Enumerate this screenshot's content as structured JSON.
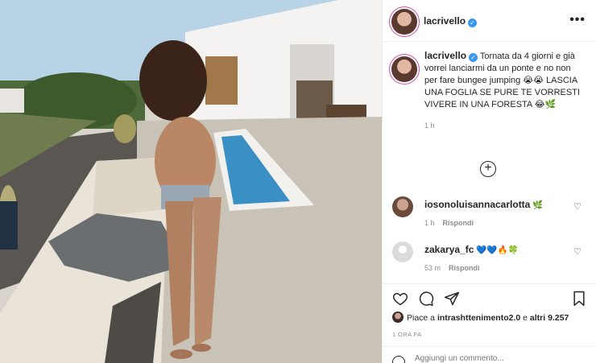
{
  "post": {
    "username": "lacrivello",
    "verified": true
  },
  "caption": {
    "username": "lacrivello",
    "text": "Tornata da 4 giorni e già vorrei lanciarmi da un ponte e no non per fare bungee jumping 😭😭 LASCIA UNA FOGLIA SE PURE TE VORRESTI VIVERE IN UNA FORESTA 😂🌿",
    "time": "1 h"
  },
  "comments": [
    {
      "username": "iosonoluisannacarlotta",
      "text": "🌿",
      "time": "1 h",
      "reply": "Rispondi"
    },
    {
      "username": "zakarya_fc",
      "text": "💙💙🔥🍀",
      "time": "53 m",
      "reply": "Rispondi"
    }
  ],
  "likes": {
    "prefix": "Piace a",
    "user": "intrashttenimento2.0",
    "connector": "e",
    "others": "altri 9.257"
  },
  "post_date": "1 ORA FA",
  "add_comment": {
    "placeholder": "Aggiungi un commento..."
  },
  "icons": {
    "more": "more-options-icon",
    "verified": "verified-badge-icon",
    "load_more": "plus-circle-icon",
    "like": "heart-icon",
    "comment": "comment-bubble-icon",
    "share": "paper-plane-icon",
    "save": "bookmark-icon",
    "emoji": "emoji-icon"
  },
  "colors": {
    "verified_blue": "#3897f0",
    "story_ring": "#d84aa6",
    "muted_text": "#8e8e8e"
  }
}
